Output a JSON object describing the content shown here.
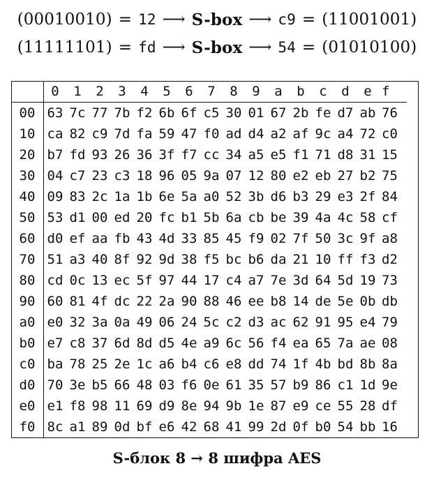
{
  "formulas": [
    {
      "input": "(00010010)",
      "eq": "=",
      "input_hex": "12",
      "arrow1": "⟶",
      "box": "S-box",
      "arrow2": "⟶",
      "output_hex": "c9",
      "eq2": "=",
      "output": "(11001001)"
    },
    {
      "input": "(11111101)",
      "eq": "=",
      "input_hex": "fd",
      "arrow1": "⟶",
      "box": "S-box",
      "arrow2": "⟶",
      "output_hex": "54",
      "eq2": "=",
      "output": "(01010100)"
    }
  ],
  "table": {
    "corner": "",
    "columns": [
      "0",
      "1",
      "2",
      "3",
      "4",
      "5",
      "6",
      "7",
      "8",
      "9",
      "a",
      "b",
      "c",
      "d",
      "e",
      "f"
    ],
    "rows": [
      {
        "head": "00",
        "cells": [
          "63",
          "7c",
          "77",
          "7b",
          "f2",
          "6b",
          "6f",
          "c5",
          "30",
          "01",
          "67",
          "2b",
          "fe",
          "d7",
          "ab",
          "76"
        ]
      },
      {
        "head": "10",
        "cells": [
          "ca",
          "82",
          "c9",
          "7d",
          "fa",
          "59",
          "47",
          "f0",
          "ad",
          "d4",
          "a2",
          "af",
          "9c",
          "a4",
          "72",
          "c0"
        ]
      },
      {
        "head": "20",
        "cells": [
          "b7",
          "fd",
          "93",
          "26",
          "36",
          "3f",
          "f7",
          "cc",
          "34",
          "a5",
          "e5",
          "f1",
          "71",
          "d8",
          "31",
          "15"
        ]
      },
      {
        "head": "30",
        "cells": [
          "04",
          "c7",
          "23",
          "c3",
          "18",
          "96",
          "05",
          "9a",
          "07",
          "12",
          "80",
          "e2",
          "eb",
          "27",
          "b2",
          "75"
        ]
      },
      {
        "head": "40",
        "cells": [
          "09",
          "83",
          "2c",
          "1a",
          "1b",
          "6e",
          "5a",
          "a0",
          "52",
          "3b",
          "d6",
          "b3",
          "29",
          "e3",
          "2f",
          "84"
        ]
      },
      {
        "head": "50",
        "cells": [
          "53",
          "d1",
          "00",
          "ed",
          "20",
          "fc",
          "b1",
          "5b",
          "6a",
          "cb",
          "be",
          "39",
          "4a",
          "4c",
          "58",
          "cf"
        ]
      },
      {
        "head": "60",
        "cells": [
          "d0",
          "ef",
          "aa",
          "fb",
          "43",
          "4d",
          "33",
          "85",
          "45",
          "f9",
          "02",
          "7f",
          "50",
          "3c",
          "9f",
          "a8"
        ]
      },
      {
        "head": "70",
        "cells": [
          "51",
          "a3",
          "40",
          "8f",
          "92",
          "9d",
          "38",
          "f5",
          "bc",
          "b6",
          "da",
          "21",
          "10",
          "ff",
          "f3",
          "d2"
        ]
      },
      {
        "head": "80",
        "cells": [
          "cd",
          "0c",
          "13",
          "ec",
          "5f",
          "97",
          "44",
          "17",
          "c4",
          "a7",
          "7e",
          "3d",
          "64",
          "5d",
          "19",
          "73"
        ]
      },
      {
        "head": "90",
        "cells": [
          "60",
          "81",
          "4f",
          "dc",
          "22",
          "2a",
          "90",
          "88",
          "46",
          "ee",
          "b8",
          "14",
          "de",
          "5e",
          "0b",
          "db"
        ]
      },
      {
        "head": "a0",
        "cells": [
          "e0",
          "32",
          "3a",
          "0a",
          "49",
          "06",
          "24",
          "5c",
          "c2",
          "d3",
          "ac",
          "62",
          "91",
          "95",
          "e4",
          "79"
        ]
      },
      {
        "head": "b0",
        "cells": [
          "e7",
          "c8",
          "37",
          "6d",
          "8d",
          "d5",
          "4e",
          "a9",
          "6c",
          "56",
          "f4",
          "ea",
          "65",
          "7a",
          "ae",
          "08"
        ]
      },
      {
        "head": "c0",
        "cells": [
          "ba",
          "78",
          "25",
          "2e",
          "1c",
          "a6",
          "b4",
          "c6",
          "e8",
          "dd",
          "74",
          "1f",
          "4b",
          "bd",
          "8b",
          "8a"
        ]
      },
      {
        "head": "d0",
        "cells": [
          "70",
          "3e",
          "b5",
          "66",
          "48",
          "03",
          "f6",
          "0e",
          "61",
          "35",
          "57",
          "b9",
          "86",
          "c1",
          "1d",
          "9e"
        ]
      },
      {
        "head": "e0",
        "cells": [
          "e1",
          "f8",
          "98",
          "11",
          "69",
          "d9",
          "8e",
          "94",
          "9b",
          "1e",
          "87",
          "e9",
          "ce",
          "55",
          "28",
          "df"
        ]
      },
      {
        "head": "f0",
        "cells": [
          "8c",
          "a1",
          "89",
          "0d",
          "bf",
          "e6",
          "42",
          "68",
          "41",
          "99",
          "2d",
          "0f",
          "b0",
          "54",
          "bb",
          "16"
        ]
      }
    ]
  },
  "caption": "S-блок 8 → 8 шифра AES"
}
